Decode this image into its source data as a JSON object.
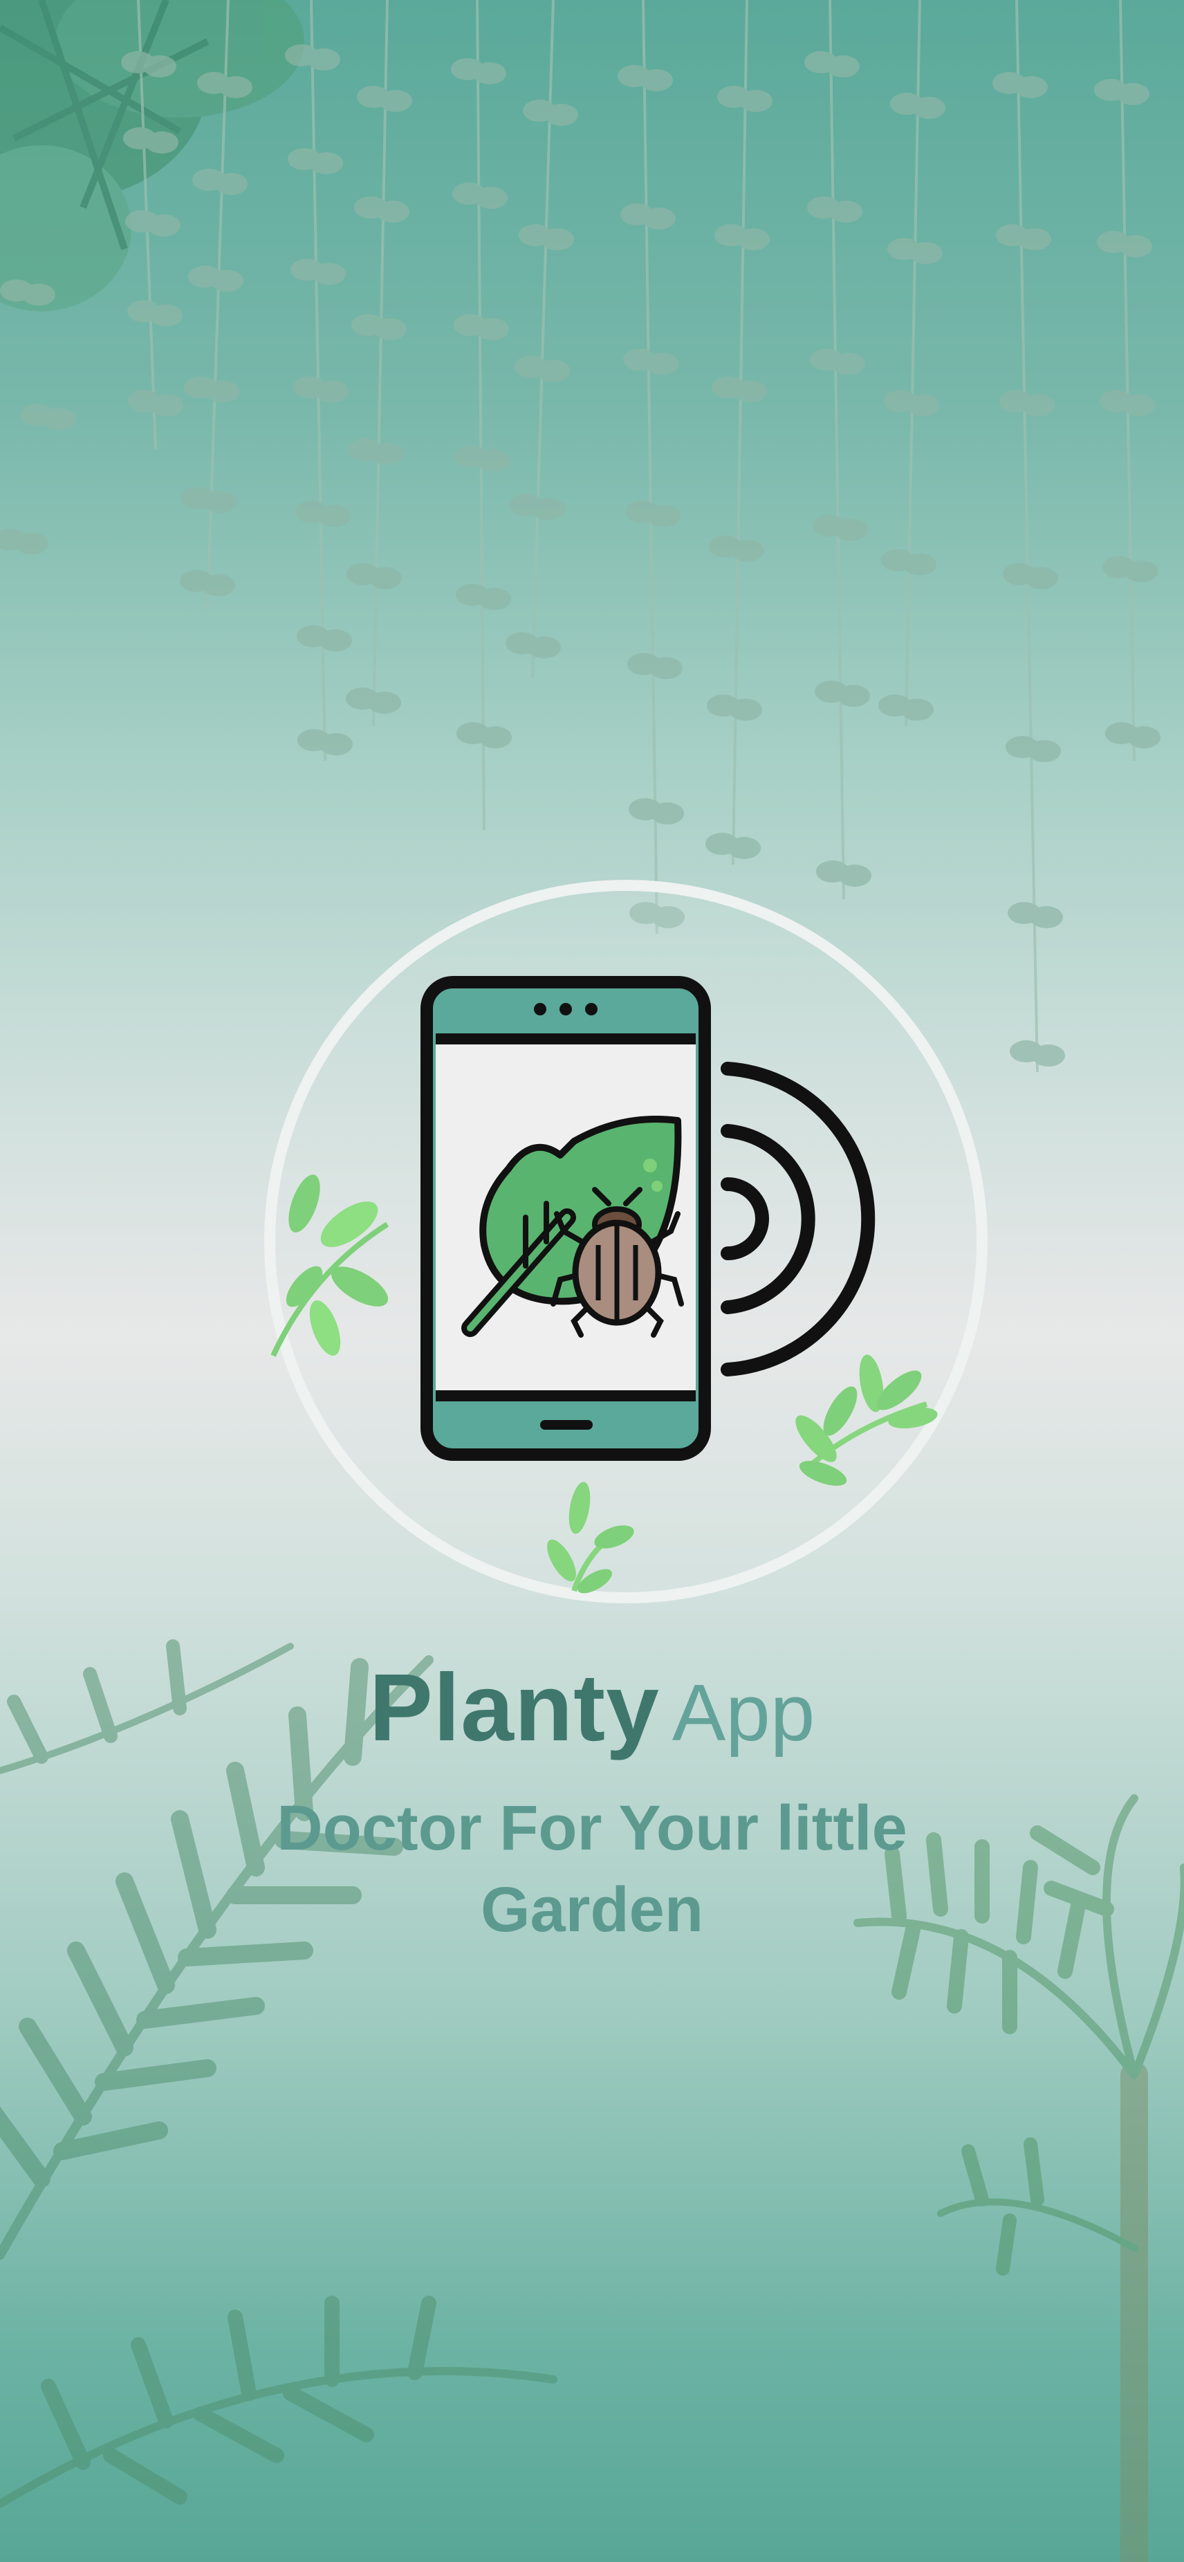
{
  "app": {
    "brand_name": "Planty",
    "brand_suffix": "App",
    "tagline": "Doctor For Your little Garden"
  },
  "hero": {
    "icon": "phone-scanning-leaf-bug-icon"
  },
  "decor": {
    "top_foliage": "hanging-vines-icon",
    "bottom_left_foliage": "palm-fronds-icon",
    "bottom_right_foliage": "palm-tree-icon",
    "sprigs": [
      "leaf-sprig-icon",
      "leaf-sprig-icon",
      "leaf-sprig-icon"
    ]
  },
  "colors": {
    "brand": "#3f776d",
    "suffix": "#64a39a",
    "tagline": "#5c9a90",
    "accent": "#5aa99a"
  }
}
